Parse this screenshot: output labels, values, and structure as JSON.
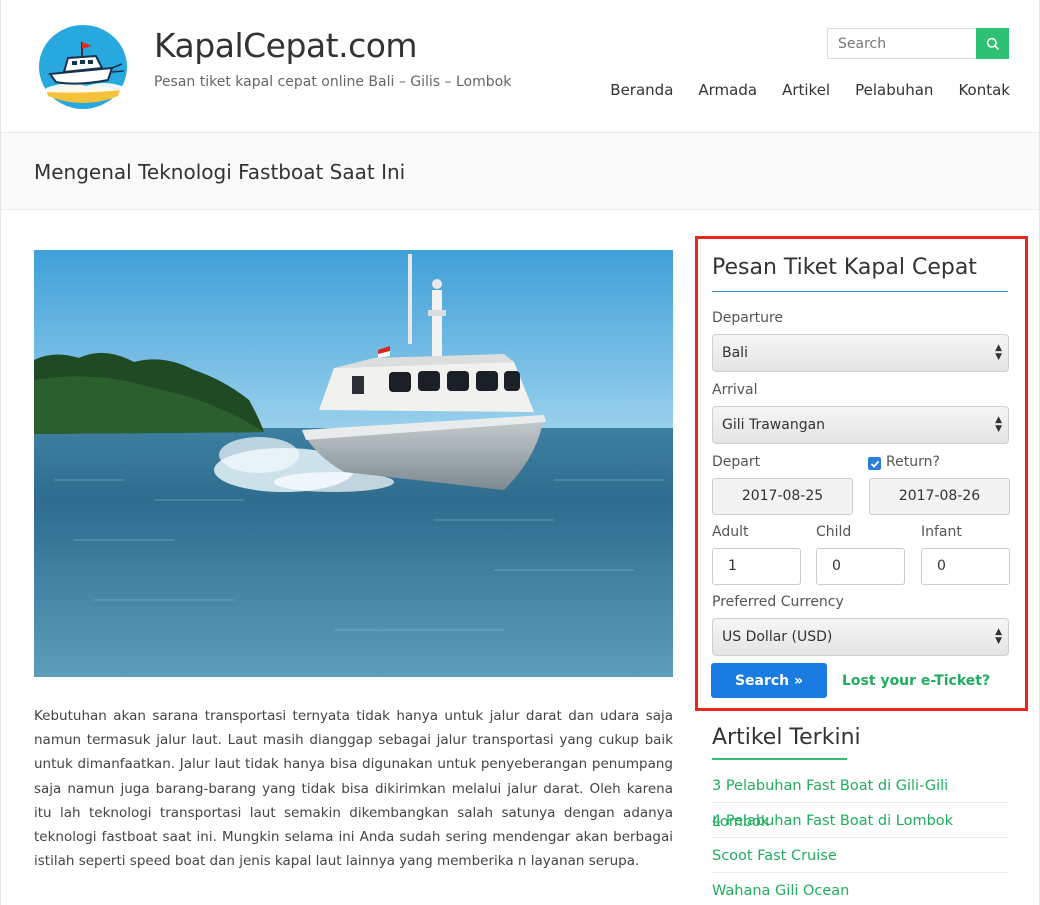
{
  "site": {
    "title": "KapalCepat.com",
    "tagline": "Pesan tiket kapal cepat online Bali – Gilis – Lombok"
  },
  "search": {
    "placeholder": "Search"
  },
  "nav": [
    {
      "label": "Beranda"
    },
    {
      "label": "Armada"
    },
    {
      "label": "Artikel"
    },
    {
      "label": "Pelabuhan"
    },
    {
      "label": "Kontak"
    }
  ],
  "page": {
    "title": "Mengenal Teknologi Fastboat Saat Ini"
  },
  "article": {
    "body": "Kebutuhan akan sarana transportasi ternyata tidak hanya untuk jalur darat dan udara saja namun termasuk jalur laut. Laut masih dianggap sebagai jalur transportasi yang cukup baik untuk dimanfaatkan. Jalur laut tidak hanya bisa digunakan untuk penyeberangan penumpang saja namun juga barang-barang yang tidak bisa dikirimkan melalui jalur darat. Oleh karena itu lah teknologi transportasi laut semakin dikembangkan salah satunya dengan adanya teknologi fastboat saat ini. Mungkin selama ini Anda sudah sering mendengar akan berbagai istilah seperti speed boat dan jenis kapal laut lainnya yang memberika   n layanan serupa."
  },
  "booking": {
    "title": "Pesan Tiket Kapal Cepat",
    "departure_label": "Departure",
    "departure_value": "Bali",
    "arrival_label": "Arrival",
    "arrival_value": "Gili Trawangan",
    "depart_label": "Depart",
    "return_label": "Return?",
    "return_checked": true,
    "depart_date": "2017-08-25",
    "return_date": "2017-08-26",
    "adult_label": "Adult",
    "child_label": "Child",
    "infant_label": "Infant",
    "adult_value": "1",
    "child_value": "0",
    "infant_value": "0",
    "currency_label": "Preferred Currency",
    "currency_value": "US Dollar (USD)",
    "search_button": "Search »",
    "lost_ticket": "Lost your e-Ticket?",
    "highlight_color": "#e8251f"
  },
  "recent": {
    "title": "Artikel Terkini",
    "items": [
      {
        "label": "3 Pelabuhan Fast Boat di Gili-Gili Lombok"
      },
      {
        "label": "4 Pelabuhan Fast Boat di Lombok"
      },
      {
        "label": "Scoot Fast Cruise"
      },
      {
        "label": "Wahana Gili Ocean"
      }
    ]
  },
  "colors": {
    "accent_green": "#2ec073",
    "link_green": "#1fae5d",
    "button_blue": "#1a7ce3",
    "title_rule_blue": "#2e8fce"
  }
}
